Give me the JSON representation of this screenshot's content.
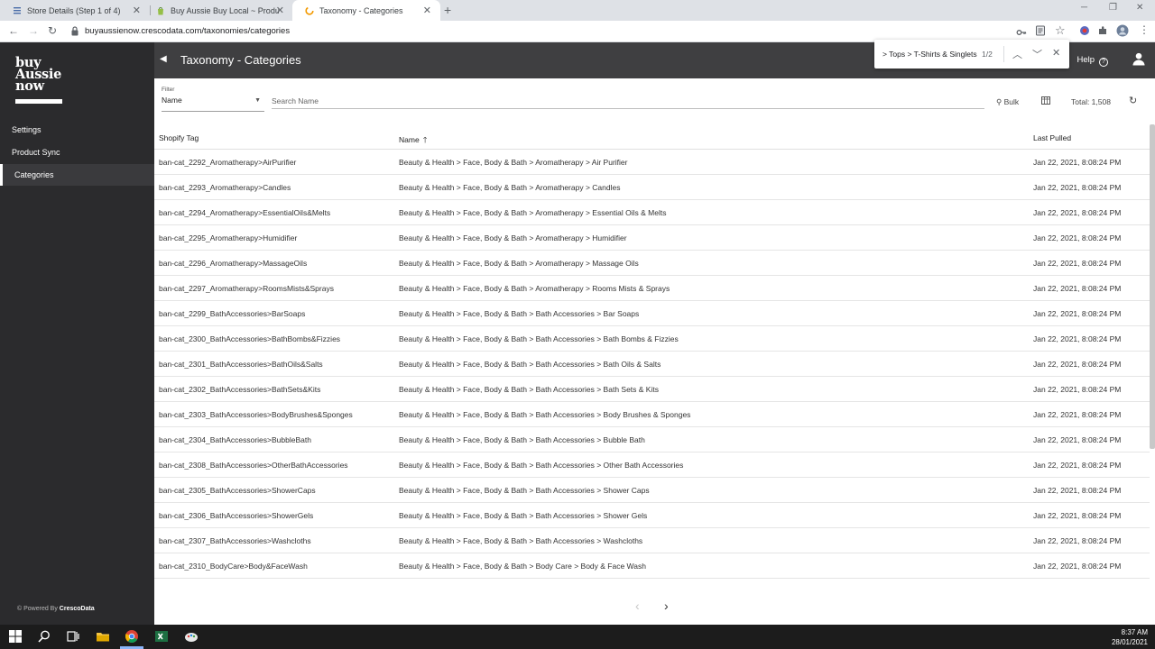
{
  "browser": {
    "tabs": [
      {
        "title": "Store Details (Step 1 of 4)",
        "active": false
      },
      {
        "title": "Buy Aussie Buy Local ~ Products",
        "active": false
      },
      {
        "title": "Taxonomy - Categories",
        "active": true
      }
    ],
    "url": "buyaussienow.crescodata.com/taxonomies/categories"
  },
  "find": {
    "query": "> Tops > T-Shirts & Singlets",
    "count": "1/2"
  },
  "sidebar": {
    "logo_lines": [
      "buy",
      "Aussie",
      "now"
    ],
    "items": [
      {
        "label": "Settings",
        "active": false
      },
      {
        "label": "Product Sync",
        "active": false
      },
      {
        "label": "Categories",
        "active": true
      }
    ],
    "powered_by_prefix": "© Powered By",
    "powered_by_brand": "CrescoData"
  },
  "header": {
    "title": "Taxonomy - Categories",
    "help_label": "Help"
  },
  "filter": {
    "label": "Filter",
    "selected": "Name",
    "search_placeholder": "Search Name",
    "bulk_label": "Bulk",
    "total_label": "Total: 1,508"
  },
  "table": {
    "columns": [
      "Shopify Tag",
      "Name",
      "Last Pulled"
    ],
    "rows": [
      [
        "ban-cat_2292_Aromatherapy>AirPurifier",
        "Beauty & Health > Face, Body & Bath > Aromatherapy > Air Purifier",
        "Jan 22, 2021, 8:08:24 PM"
      ],
      [
        "ban-cat_2293_Aromatherapy>Candles",
        "Beauty & Health > Face, Body & Bath > Aromatherapy > Candles",
        "Jan 22, 2021, 8:08:24 PM"
      ],
      [
        "ban-cat_2294_Aromatherapy>EssentialOils&Melts",
        "Beauty & Health > Face, Body & Bath > Aromatherapy > Essential Oils & Melts",
        "Jan 22, 2021, 8:08:24 PM"
      ],
      [
        "ban-cat_2295_Aromatherapy>Humidifier",
        "Beauty & Health > Face, Body & Bath > Aromatherapy > Humidifier",
        "Jan 22, 2021, 8:08:24 PM"
      ],
      [
        "ban-cat_2296_Aromatherapy>MassageOils",
        "Beauty & Health > Face, Body & Bath > Aromatherapy > Massage Oils",
        "Jan 22, 2021, 8:08:24 PM"
      ],
      [
        "ban-cat_2297_Aromatherapy>RoomsMists&Sprays",
        "Beauty & Health > Face, Body & Bath > Aromatherapy > Rooms Mists & Sprays",
        "Jan 22, 2021, 8:08:24 PM"
      ],
      [
        "ban-cat_2299_BathAccessories>BarSoaps",
        "Beauty & Health > Face, Body & Bath > Bath Accessories > Bar Soaps",
        "Jan 22, 2021, 8:08:24 PM"
      ],
      [
        "ban-cat_2300_BathAccessories>BathBombs&Fizzies",
        "Beauty & Health > Face, Body & Bath > Bath Accessories > Bath Bombs & Fizzies",
        "Jan 22, 2021, 8:08:24 PM"
      ],
      [
        "ban-cat_2301_BathAccessories>BathOils&Salts",
        "Beauty & Health > Face, Body & Bath > Bath Accessories > Bath Oils & Salts",
        "Jan 22, 2021, 8:08:24 PM"
      ],
      [
        "ban-cat_2302_BathAccessories>BathSets&Kits",
        "Beauty & Health > Face, Body & Bath > Bath Accessories > Bath Sets & Kits",
        "Jan 22, 2021, 8:08:24 PM"
      ],
      [
        "ban-cat_2303_BathAccessories>BodyBrushes&Sponges",
        "Beauty & Health > Face, Body & Bath > Bath Accessories > Body Brushes & Sponges",
        "Jan 22, 2021, 8:08:24 PM"
      ],
      [
        "ban-cat_2304_BathAccessories>BubbleBath",
        "Beauty & Health > Face, Body & Bath > Bath Accessories > Bubble Bath",
        "Jan 22, 2021, 8:08:24 PM"
      ],
      [
        "ban-cat_2308_BathAccessories>OtherBathAccessories",
        "Beauty & Health > Face, Body & Bath > Bath Accessories > Other Bath Accessories",
        "Jan 22, 2021, 8:08:24 PM"
      ],
      [
        "ban-cat_2305_BathAccessories>ShowerCaps",
        "Beauty & Health > Face, Body & Bath > Bath Accessories > Shower Caps",
        "Jan 22, 2021, 8:08:24 PM"
      ],
      [
        "ban-cat_2306_BathAccessories>ShowerGels",
        "Beauty & Health > Face, Body & Bath > Bath Accessories > Shower Gels",
        "Jan 22, 2021, 8:08:24 PM"
      ],
      [
        "ban-cat_2307_BathAccessories>Washcloths",
        "Beauty & Health > Face, Body & Bath > Bath Accessories > Washcloths",
        "Jan 22, 2021, 8:08:24 PM"
      ],
      [
        "ban-cat_2310_BodyCare>Body&FaceWash",
        "Beauty & Health > Face, Body & Bath > Body Care > Body & Face Wash",
        "Jan 22, 2021, 8:08:24 PM"
      ]
    ]
  },
  "taskbar": {
    "time": "8:37 AM",
    "date": "28/01/2021"
  },
  "colors": {
    "sidebar_bg": "#2b2b2d",
    "header_bg": "#3f3f41",
    "taskbar_bg": "#1c1c1c"
  }
}
